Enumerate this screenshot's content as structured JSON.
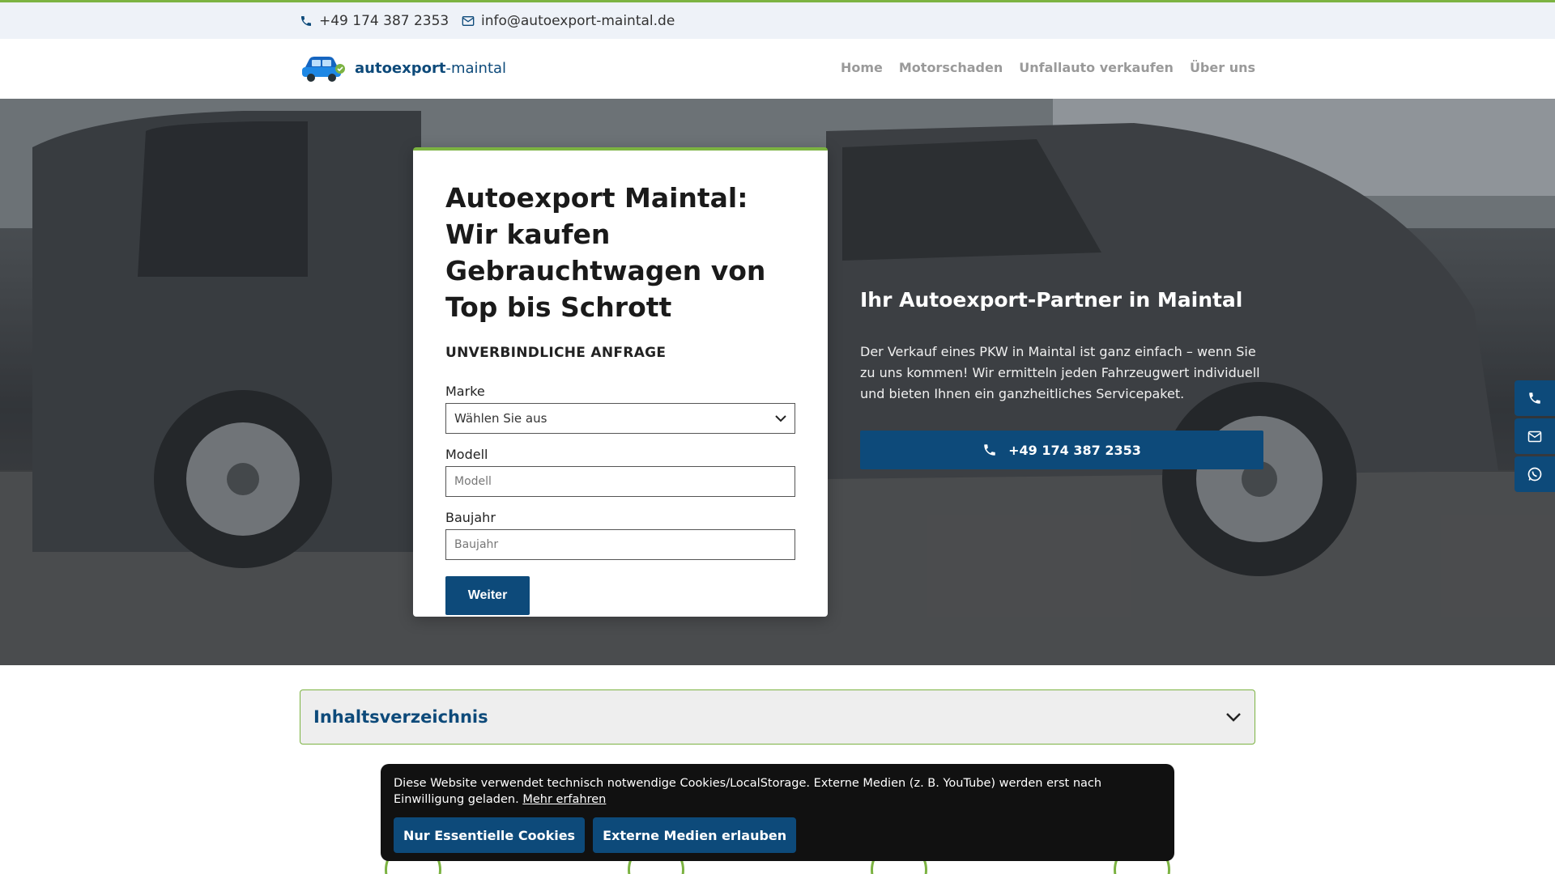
{
  "topbar": {
    "phone": "+49 174 387 2353",
    "email": "info@autoexport-maintal.de"
  },
  "header": {
    "logo_bold": "autoexport",
    "logo_light": "-maintal",
    "nav": [
      "Home",
      "Motorschaden",
      "Unfallauto verkaufen",
      "Über uns"
    ]
  },
  "form": {
    "title": "Autoexport Maintal: Wir kaufen Gebrauchtwagen von Top bis Schrott",
    "subtitle": "UNVERBINDLICHE ANFRAGE",
    "marke_label": "Marke",
    "marke_value": "Wählen Sie aus",
    "modell_label": "Modell",
    "modell_placeholder": "Modell",
    "baujahr_label": "Baujahr",
    "baujahr_placeholder": "Baujahr",
    "submit_label": "Weiter"
  },
  "hero": {
    "heading": "Ihr Autoexport-Partner in Maintal",
    "text": "Der Verkauf eines PKW in Maintal ist ganz einfach – wenn Sie zu uns kommen! Wir ermitteln jeden Fahrzeugwert individuell und bieten Ihnen ein ganzheitliches Servicepaket.",
    "phone_button": "+49 174 387 2353"
  },
  "side_buttons": [
    "phone-icon",
    "mail-icon",
    "whatsapp-icon"
  ],
  "toc": {
    "title": "Inhaltsverzeichnis"
  },
  "cookie": {
    "text": "Diese Website verwendet technisch notwendige Cookies/LocalStorage. Externe Medien (z. B. YouTube) werden erst nach Einwilligung geladen.",
    "link": "Mehr erfahren",
    "btn_essential": "Nur Essentielle Cookies",
    "btn_external": "Externe Medien erlauben"
  },
  "colors": {
    "brand_blue": "#0d4a7a",
    "accent_green": "#7cb342"
  }
}
